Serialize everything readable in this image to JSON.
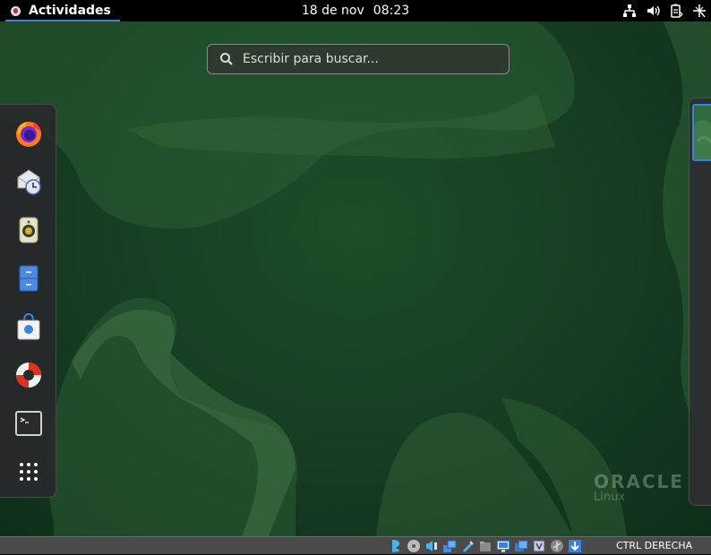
{
  "topbar": {
    "activities_label": "Actividades",
    "date": "18 de nov",
    "time": "08:23",
    "tray": [
      "network-icon",
      "volume-icon",
      "battery-icon",
      "power-icon"
    ]
  },
  "search": {
    "placeholder": "Escribir para buscar..."
  },
  "dash": {
    "apps": [
      {
        "name": "firefox",
        "icon": "firefox-icon"
      },
      {
        "name": "evolution",
        "icon": "mail-clock-icon"
      },
      {
        "name": "rhythmbox",
        "icon": "speaker-icon"
      },
      {
        "name": "files",
        "icon": "file-cabinet-icon"
      },
      {
        "name": "software",
        "icon": "shopping-bag-icon"
      },
      {
        "name": "help",
        "icon": "lifebuoy-icon"
      },
      {
        "name": "terminal",
        "icon": "terminal-icon"
      },
      {
        "name": "show-applications",
        "icon": "app-grid-icon"
      }
    ]
  },
  "branding": {
    "name": "ORACLE",
    "sub": "Linux"
  },
  "statusbar": {
    "host_key": "CTRL DERECHA"
  },
  "colors": {
    "accent": "#3584e4",
    "desktop": "#173f23",
    "statusbar": "#4a4a4a"
  }
}
